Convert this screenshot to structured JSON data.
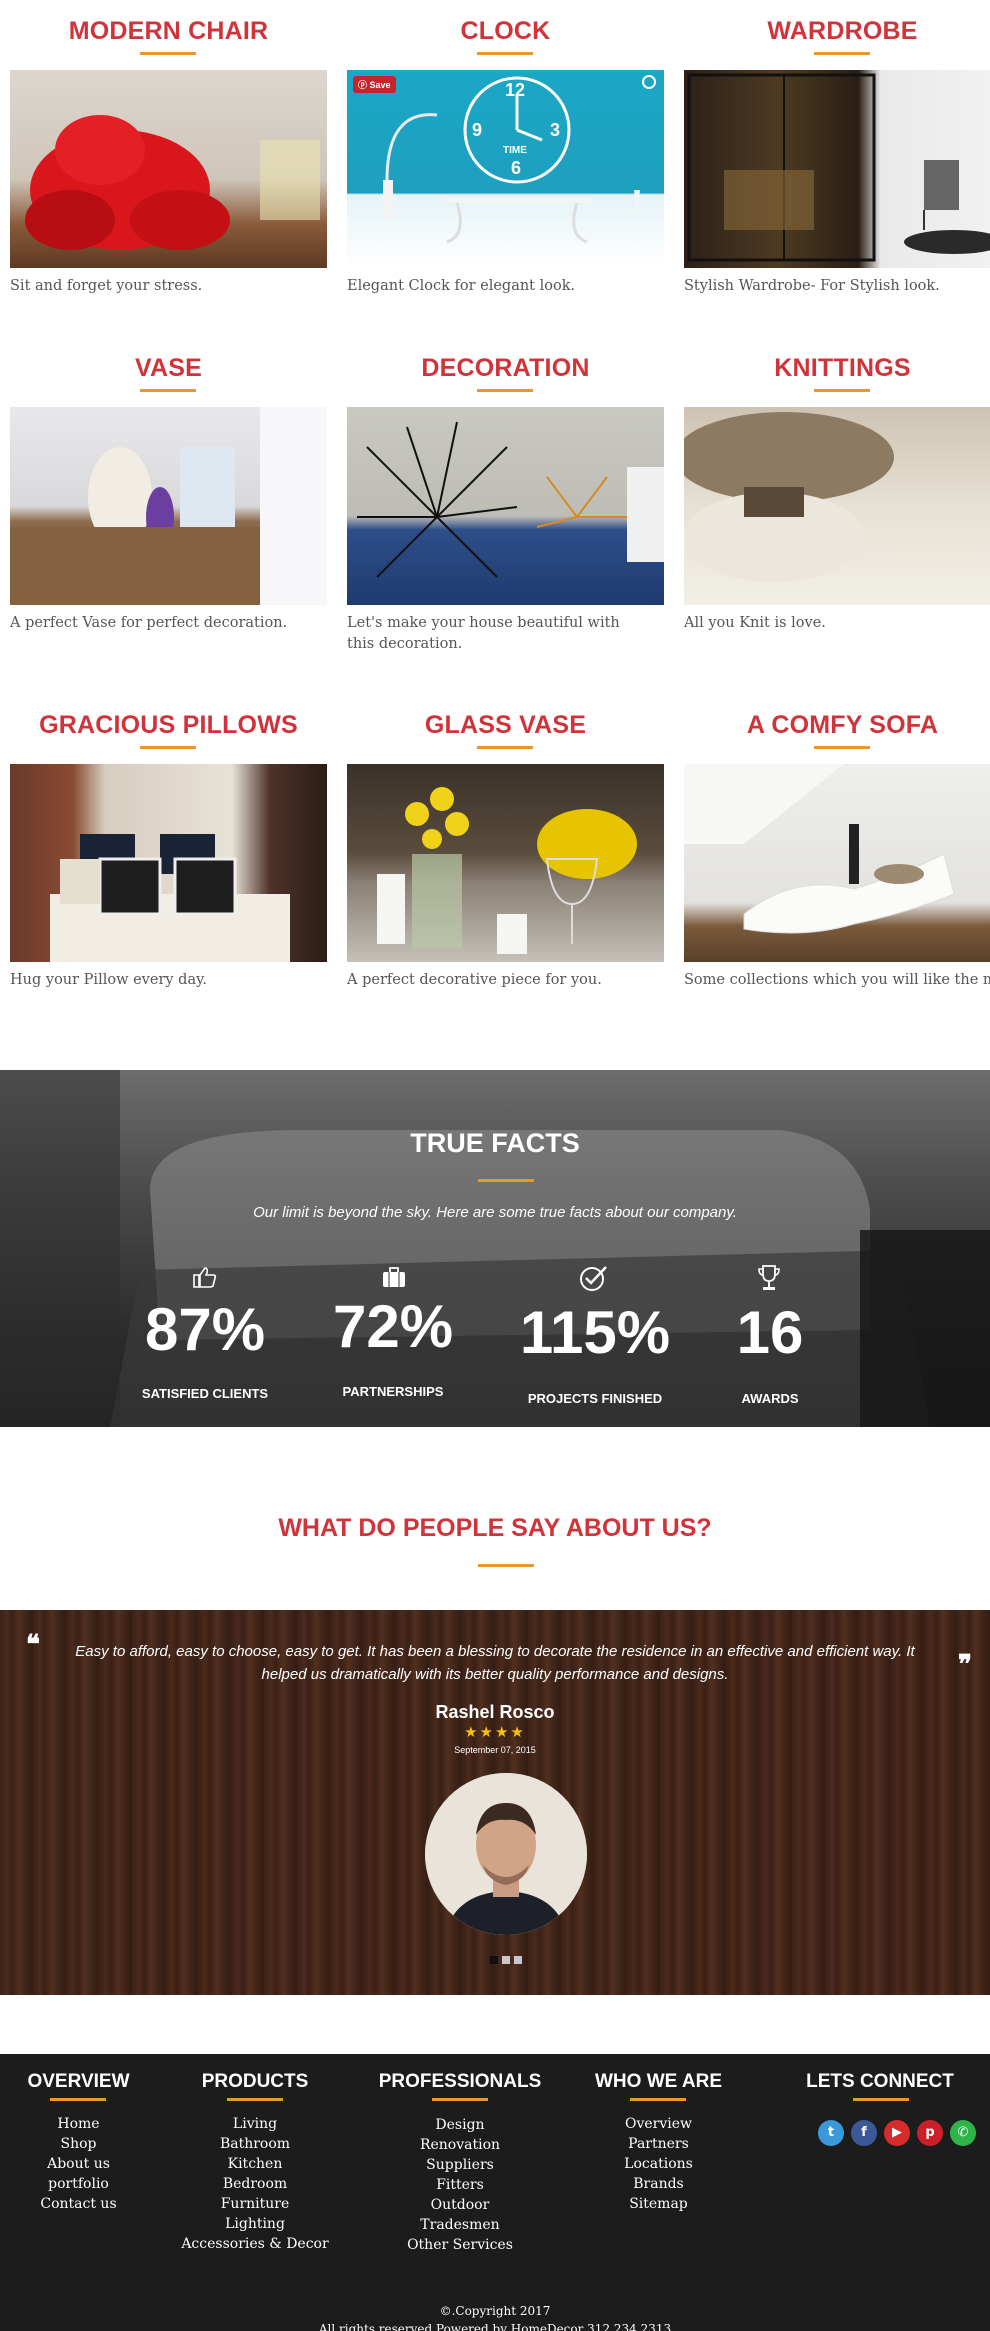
{
  "products": [
    {
      "title": "MODERN CHAIR",
      "desc": "Sit and forget your stress."
    },
    {
      "title": "CLOCK",
      "desc": "Elegant Clock for elegant look.",
      "save_label": "Save"
    },
    {
      "title": "WARDROBE",
      "desc": "Stylish Wardrobe- For Stylish look."
    },
    {
      "title": "VASE",
      "desc": "A perfect Vase for perfect decoration."
    },
    {
      "title": "DECORATION",
      "desc": "Let's make your house beautiful with this decoration."
    },
    {
      "title": "KNITTINGS",
      "desc": "All you Knit is love."
    },
    {
      "title": "GRACIOUS PILLOWS",
      "desc": "Hug your Pillow every day."
    },
    {
      "title": "GLASS VASE",
      "desc": "A perfect decorative piece for you."
    },
    {
      "title": "A COMFY SOFA",
      "desc": "Some collections which you will like the most."
    }
  ],
  "clock_numerals": {
    "n12": "12",
    "n3": "3",
    "n6": "6",
    "n9": "9",
    "word": "TIME"
  },
  "facts": {
    "title": "TRUE FACTS",
    "subtitle": "Our limit is beyond the sky. Here are some true facts about our company.",
    "items": [
      {
        "value": "87%",
        "label": "SATISFIED CLIENTS",
        "icon": "thumbs-up-icon"
      },
      {
        "value": "72%",
        "label": "PARTNERSHIPS",
        "icon": "briefcase-icon"
      },
      {
        "value": "115%",
        "label": "PROJECTS FINISHED",
        "icon": "check-badge-icon"
      },
      {
        "value": "16",
        "label": "AWARDS",
        "icon": "trophy-icon"
      }
    ]
  },
  "testimonials": {
    "title": "WHAT DO PEOPLE SAY ABOUT US?",
    "quote": "Easy to afford, easy to choose, easy to get. It has been a blessing to decorate the residence in an effective and efficient way. It helped us dramatically with its better quality performance and designs.",
    "open_quote": "❝",
    "close_quote": "❞",
    "name": "Rashel Rosco",
    "stars": "★★★★",
    "rating": 4,
    "date": "September 07, 2015",
    "active_dot": 0
  },
  "footer": {
    "columns": [
      {
        "title": "OVERVIEW",
        "links": [
          "Home",
          "Shop",
          "About us",
          "portfolio",
          "Contact us"
        ]
      },
      {
        "title": "PRODUCTS",
        "links": [
          "Living",
          "Bathroom",
          "Kitchen",
          "Bedroom",
          "Furniture",
          "Lighting",
          "Accessories & Decor"
        ]
      },
      {
        "title": "PROFESSIONALS",
        "links": [
          "Design",
          "Renovation",
          "Suppliers",
          "Fitters",
          "Outdoor",
          "Tradesmen",
          "Other Services"
        ]
      },
      {
        "title": "WHO WE ARE",
        "links": [
          "Overview",
          "Partners",
          "Locations",
          "Brands",
          "Sitemap"
        ]
      }
    ],
    "connect_title": "LETS CONNECT",
    "social": [
      {
        "name": "twitter-icon",
        "glyph": "t",
        "color": "#3a9ad9"
      },
      {
        "name": "facebook-icon",
        "glyph": "f",
        "color": "#3b5998"
      },
      {
        "name": "youtube-icon",
        "glyph": "▶",
        "color": "#d52b2b"
      },
      {
        "name": "pinterest-icon",
        "glyph": "p",
        "color": "#cb2027"
      },
      {
        "name": "whatsapp-icon",
        "glyph": "✆",
        "color": "#2fb44a"
      }
    ],
    "copyright": "©.Copyright 2017",
    "rights": "All rights reserved Powered by HomeDecor 312 234 2313"
  }
}
